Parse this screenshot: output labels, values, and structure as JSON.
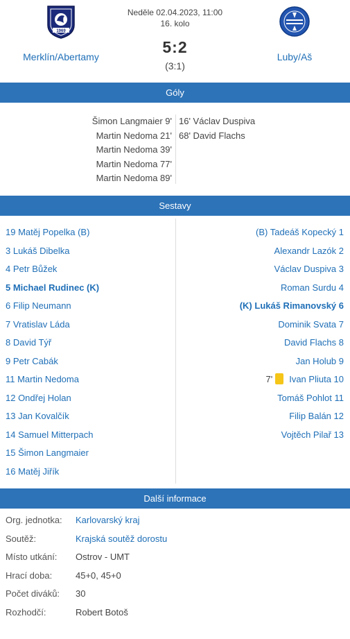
{
  "match": {
    "date": "Neděle 02.04.2023, 11:00",
    "round": "16. kolo",
    "score": "5:2",
    "halftime": "(3:1)",
    "home_team": "Merklín/Abertamy",
    "away_team": "Luby/Aš",
    "home_logo_text": "1969",
    "away_logo_text": "TJ JISKRA AŠ"
  },
  "sections": {
    "goals": "Góly",
    "lineups": "Sestavy",
    "info": "Další informace"
  },
  "goals": {
    "home": [
      "Šimon Langmaier 9'",
      "Martin Nedoma 21'",
      "Martin Nedoma 39'",
      "Martin Nedoma 77'",
      "Martin Nedoma 89'"
    ],
    "away": [
      "16' Václav Duspiva",
      "68' David Flachs"
    ]
  },
  "lineups": {
    "home": [
      "19 Matěj Popelka  (B)",
      "3 Lukáš Dibelka",
      "4 Petr Bůžek",
      "5 Michael Rudinec  (K)",
      "6 Filip Neumann",
      "7 Vratislav Láda",
      "8 David Týř",
      "9 Petr Cabák",
      "11 Martin Nedoma",
      "12 Ondřej Holan",
      "13 Jan Kovalčík",
      "14 Samuel Mitterpach",
      "15 Šimon Langmaier",
      "16 Matěj Jiřík"
    ],
    "away": [
      "(B) Tadeáš Kopecký 1",
      "Alexandr Lazók 2",
      "Václav Duspiva 3",
      "Roman Surdu 4",
      "(K) Lukáš Rimanovský 6",
      "Dominik Svata 7",
      "David Flachs 8",
      "Jan Holub 9",
      "Ivan Pliuta 10",
      "Tomáš Pohlot 11",
      "Filip Balán 12",
      "Vojtěch Pilař 13"
    ],
    "away_card_minute": "7'"
  },
  "info": {
    "org_label": "Org. jednotka:",
    "org_value": "Karlovarský kraj",
    "comp_label": "Soutěž:",
    "comp_value": "Krajská soutěž dorostu",
    "venue_label": "Místo utkání:",
    "venue_value": "Ostrov - UMT",
    "time_label": "Hrací doba:",
    "time_value": "45+0, 45+0",
    "spect_label": "Počet diváků:",
    "spect_value": "30",
    "ref_label": "Rozhodčí:",
    "ref_value": "Robert Botoš"
  },
  "colors": {
    "accent": "#2d73b8",
    "link": "#1f6fb7",
    "yellow_card": "#f5c518"
  }
}
